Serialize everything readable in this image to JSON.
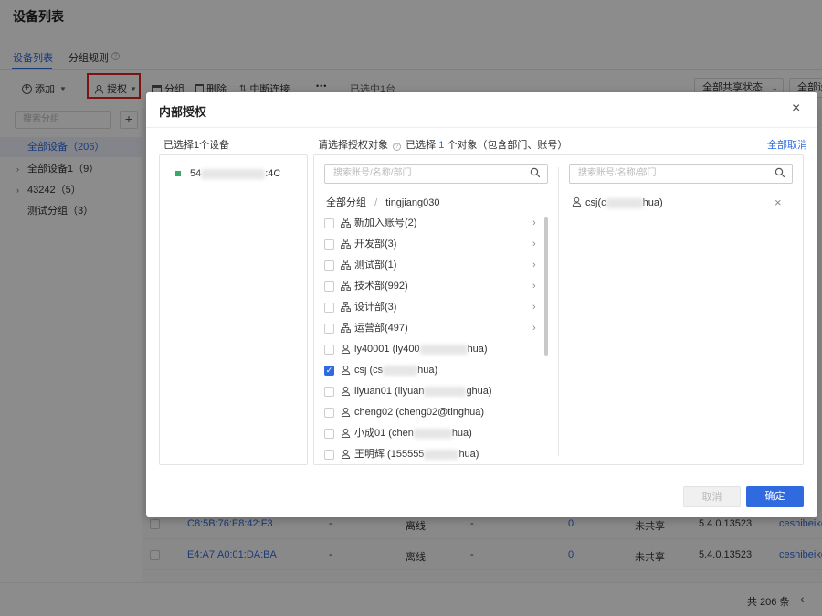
{
  "page": {
    "title": "设备列表"
  },
  "tabs": [
    {
      "label": "设备列表"
    },
    {
      "label": "分组规则"
    }
  ],
  "toolbar": {
    "add": "添加",
    "authorize": "授权",
    "group": "分组",
    "delete": "删除",
    "disconnect": "中断连接",
    "more": "•••",
    "selected": "已选中1台",
    "share_filter": "全部共享状态",
    "second_filter": "全部设"
  },
  "sidebar": {
    "search_placeholder": "搜索分组",
    "add": "+",
    "items": [
      {
        "label": "全部设备（206）"
      },
      {
        "label": "全部设备1（9）"
      },
      {
        "label": "43242（5）"
      },
      {
        "label": "测试分组（3）"
      }
    ]
  },
  "table_rows": [
    {
      "mac": "C8:5B:76:E8:42:F3",
      "c2": "-",
      "status": "离线",
      "c4": "-",
      "count": "0",
      "share": "未共享",
      "version": "5.4.0.13523",
      "owner": "ceshibeike"
    },
    {
      "mac": "E4:A7:A0:01:DA:BA",
      "c2": "-",
      "status": "离线",
      "c4": "-",
      "count": "0",
      "share": "未共享",
      "version": "5.4.0.13523",
      "owner": "ceshibeike"
    }
  ],
  "footer": {
    "total": "共 206 条",
    "prev": "‹"
  },
  "modal": {
    "title": "内部授权",
    "close": "×",
    "device_header": "已选择1个设备",
    "device_prefix": "54",
    "device_suffix": ":4C",
    "target_label": "请选择授权对象",
    "selected_prefix": "已选择",
    "selected_count": "1",
    "selected_suffix": "个对象（包含部门、账号）",
    "clear_all": "全部取消",
    "search_placeholder": "搜索账号/名称/部门",
    "breadcrumb": {
      "root": "全部分组",
      "sep": "/",
      "current": "tingjiang030"
    },
    "departments": [
      {
        "name": "新加入账号(2)"
      },
      {
        "name": "开发部(3)"
      },
      {
        "name": "测试部(1)"
      },
      {
        "name": "技术部(992)"
      },
      {
        "name": "设计部(3)"
      },
      {
        "name": "运营部(497)"
      }
    ],
    "users": [
      {
        "a": "ly40001 (ly400",
        "b": "hua)",
        "checked": false
      },
      {
        "a": "csj (cs",
        "b": "hua)",
        "checked": true
      },
      {
        "a": "liyuan01 (liyuan",
        "b": "ghua)",
        "checked": false
      },
      {
        "a": "cheng02 (cheng02@tinghua)",
        "b": "",
        "checked": false
      },
      {
        "a": "小成01 (chen",
        "b": "hua)",
        "checked": false
      },
      {
        "a": "王明辉 (155555",
        "b": "hua)",
        "checked": false
      }
    ],
    "right_search_placeholder": "搜索账号/名称/部门",
    "selected_item": {
      "a": "csj(c",
      "b": "hua)"
    },
    "remove": "×",
    "cancel": "取消",
    "confirm": "确定"
  }
}
